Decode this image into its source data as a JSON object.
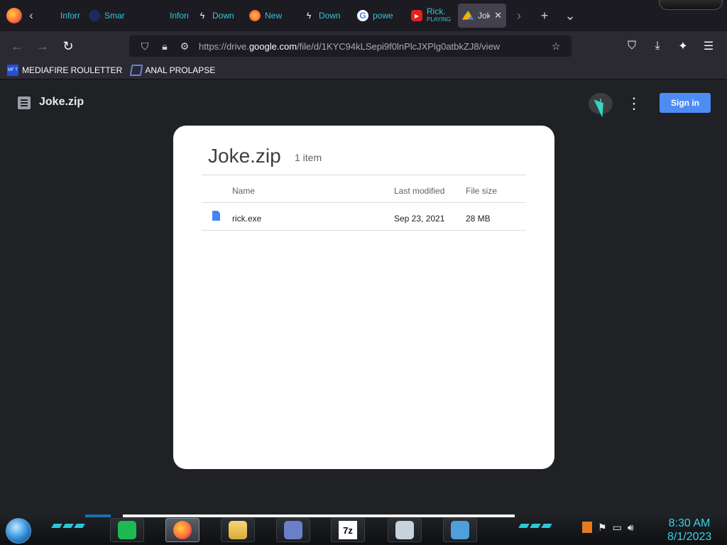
{
  "browser": {
    "tabs": [
      {
        "label": "Inform",
        "icon": "info-icon"
      },
      {
        "label": "Smar",
        "icon": "smart-icon"
      },
      {
        "label": "Inform",
        "icon": "info-icon"
      },
      {
        "label": "Down",
        "icon": "lightning-icon"
      },
      {
        "label": "New",
        "icon": "firefox-icon"
      },
      {
        "label": "Down",
        "icon": "lightning-icon"
      },
      {
        "label": "powe",
        "icon": "google-icon"
      },
      {
        "label": "Rick.",
        "sub": "PLAYING",
        "icon": "youtube-icon"
      },
      {
        "label": "Jok",
        "icon": "drive-icon",
        "active": true
      }
    ],
    "url_prefix": "https://drive.",
    "url_domain": "google.com",
    "url_path": "/file/d/1KYC94kLSepi9f0lnPlcJXPlg0atbkZJ8/view",
    "bookmarks": [
      {
        "icon_text": "MF T",
        "label": "MEDIAFIRE ROULETTER"
      },
      {
        "label": "ANAL PROLAPSE"
      }
    ]
  },
  "viewer": {
    "header_title": "Joke.zip",
    "sign_in_label": "Sign in",
    "card": {
      "title": "Joke.zip",
      "count": "1 item",
      "columns": [
        "Name",
        "Last modified",
        "File size"
      ],
      "rows": [
        {
          "name": "rick.exe",
          "modified": "Sep 23, 2021",
          "size": "28 MB"
        }
      ]
    }
  },
  "taskbar": {
    "time": "8:30 AM",
    "date": "8/1/2023"
  },
  "colors": {
    "accent": "#39c5d6",
    "sign_in": "#4e8cf5",
    "clock": "#39d3e4"
  }
}
